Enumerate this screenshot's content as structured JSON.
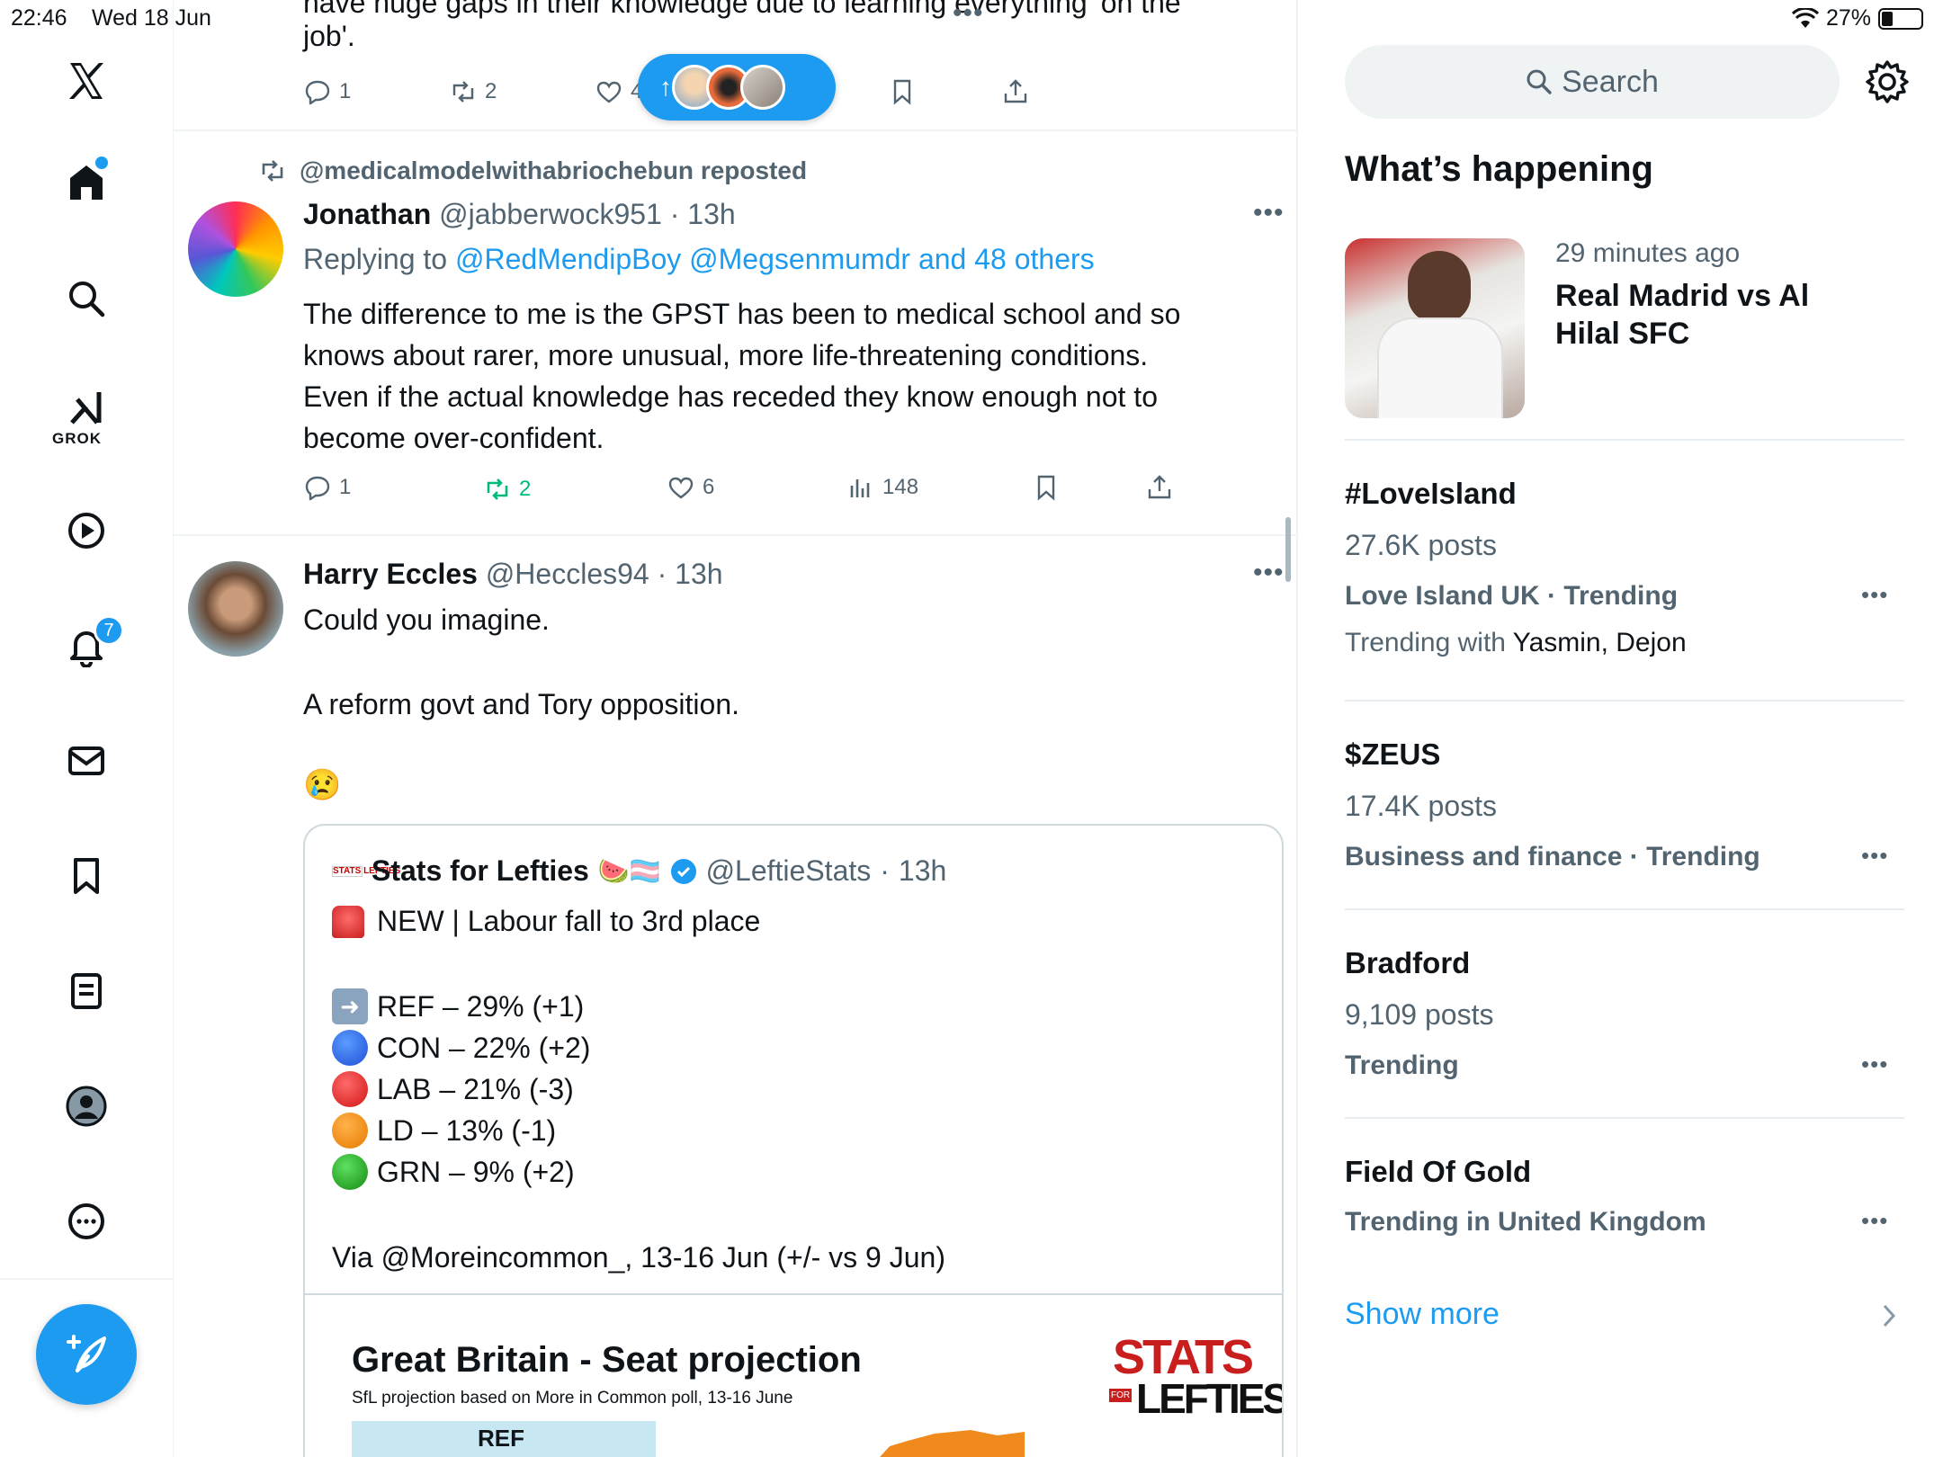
{
  "status_bar": {
    "time": "22:46",
    "date": "Wed 18 Jun",
    "battery": "27%"
  },
  "nav": {
    "grok_label": "GROK",
    "notifications_badge": "7"
  },
  "new_posts_pill": {
    "label": "↑"
  },
  "top_post": {
    "text_partial": "have huge gaps in their knowledge due to learning everything 'on the",
    "text_end": "job'.",
    "replies": "1",
    "reposts": "2",
    "likes": "4"
  },
  "post1": {
    "repost_context": "@medicalmodelwithabriochebun reposted",
    "name": "Jonathan",
    "handle": "@jabberwock951",
    "time": "13h",
    "replying_label": "Replying to",
    "replying_to": "@RedMendipBoy @Megsenmumdr and 48 others",
    "lines": [
      "The difference to me is the GPST has been to medical school and so",
      "knows about rarer, more unusual, more life-threatening conditions.",
      "Even if the actual knowledge has receded they know enough not to",
      "become over-confident."
    ],
    "replies": "1",
    "reposts": "2",
    "likes": "6",
    "views": "148"
  },
  "post2": {
    "name": "Harry Eccles",
    "handle": "@Heccles94",
    "time": "13h",
    "line1": "Could you imagine.",
    "line2": "A reform govt and Tory opposition.",
    "emoji": "😢",
    "quote": {
      "logo_text": "STATS LEFTIES",
      "name": "Stats for Lefties",
      "name_emojis": "🍉🏳️‍⚧️",
      "handle": "@LeftieStats",
      "time": "13h",
      "headline": "NEW | Labour fall to 3rd place",
      "results": [
        {
          "text": "REF – 29% (+1)",
          "color": "#3b82f6",
          "marker": "➡️"
        },
        {
          "text": "CON – 22% (+2)",
          "color": "#1e5bd6",
          "marker": "🔵"
        },
        {
          "text": "LAB – 21% (-3)",
          "color": "#e11d1d",
          "marker": "🔴"
        },
        {
          "text": "LD – 13% (-1)",
          "color": "#f08a0c",
          "marker": "🟠"
        },
        {
          "text": "GRN – 9% (+2)",
          "color": "#16a34a",
          "marker": "🟢"
        }
      ],
      "via": "Via @Moreincommon_, 13-16 Jun (+/- vs 9 Jun)",
      "card_title": "Great Britain - Seat projection",
      "card_subtitle": "SfL projection based on More in Common poll, 13-16 June",
      "card_bar_label": "REF",
      "card_logo_line1": "STATS",
      "card_logo_line2": "LEFTIES",
      "card_logo_for": "FOR"
    }
  },
  "right": {
    "search_placeholder": "Search",
    "section_title": "What’s happening",
    "news": {
      "time": "29 minutes ago",
      "title_line1": "Real Madrid vs Al",
      "title_line2": "Hilal SFC"
    },
    "trends": [
      {
        "title": "#LoveIsland",
        "posts": "27.6K posts",
        "meta": "Love Island UK · Trending",
        "with_label": "Trending with",
        "with_names": "Yasmin, Dejon"
      },
      {
        "title": "$ZEUS",
        "posts": "17.4K posts",
        "meta": "Business and finance · Trending"
      },
      {
        "title": "Bradford",
        "posts": "9,109 posts",
        "meta": "Trending"
      },
      {
        "title": "Field Of Gold",
        "meta": "Trending in United Kingdom"
      }
    ],
    "show_more": "Show more"
  },
  "colors": {
    "accent": "#1d9bf0",
    "repost_green": "#00ba7c",
    "muted": "#536471"
  }
}
